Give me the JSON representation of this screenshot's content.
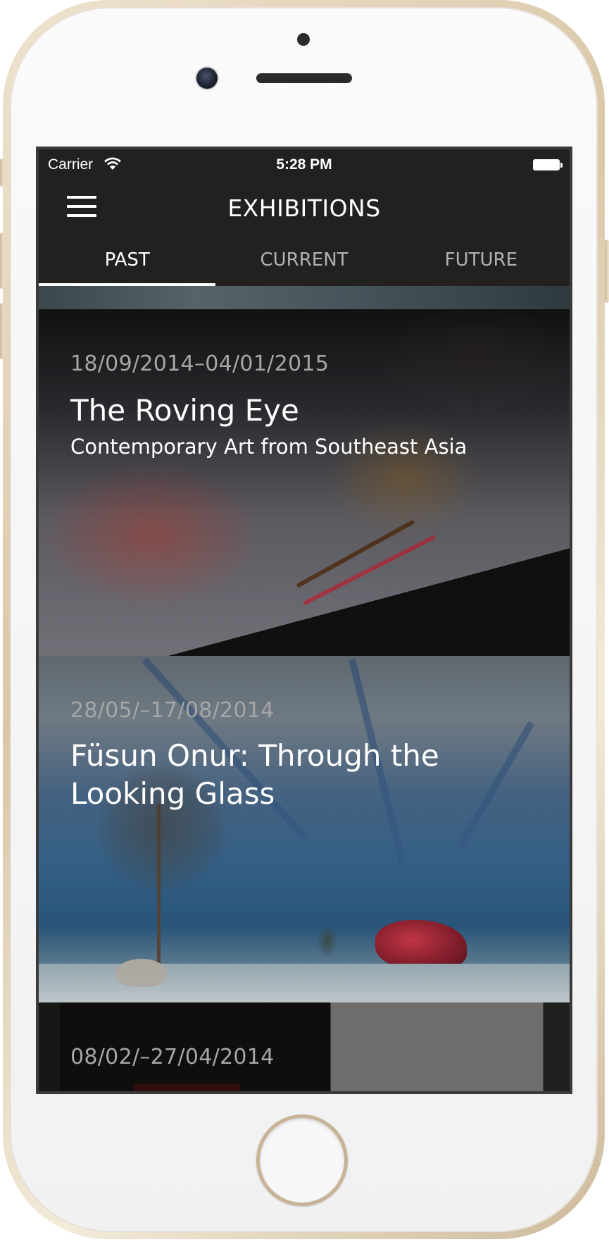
{
  "status_bar": {
    "carrier": "Carrier",
    "time": "5:28 PM",
    "wifi_icon": "wifi-icon",
    "battery_icon": "battery-icon"
  },
  "nav_bar": {
    "menu_icon": "hamburger-menu-icon",
    "title": "EXHIBITIONS"
  },
  "tabs": [
    {
      "label": "PAST",
      "active": true
    },
    {
      "label": "CURRENT",
      "active": false
    },
    {
      "label": "FUTURE",
      "active": false
    }
  ],
  "exhibitions": [
    {
      "dates": "18/09/2014–04/01/2015",
      "title": "The Roving Eye",
      "subtitle": "Contemporary Art from Southeast Asia"
    },
    {
      "dates": "28/05/–17/08/2014",
      "title": "Füsun Onur: Through the Looking Glass"
    },
    {
      "dates": "08/02/–27/04/2014"
    }
  ],
  "colors": {
    "bar_background": "#222120",
    "active_tab": "#ffffff",
    "inactive_tab": "#b2b2b2",
    "date_text": "#a6a6a6"
  }
}
